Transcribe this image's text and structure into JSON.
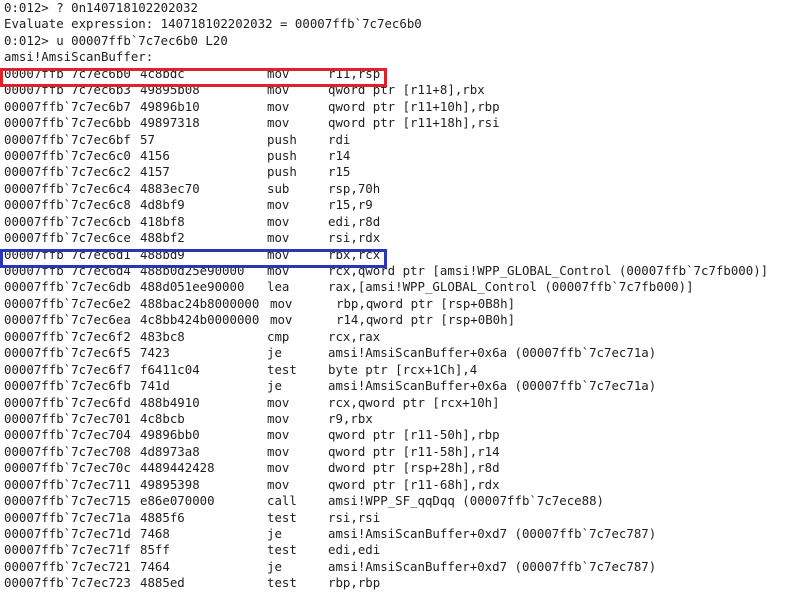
{
  "colors": {
    "red_box": "#e0202a",
    "blue_box": "#2a36b8"
  },
  "header_lines": [
    "0:012> ? 0n140718102202032",
    "Evaluate expression: 140718102202032 = 00007ffb`7c7ec6b0",
    "0:012> u 00007ffb`7c7ec6b0 L20",
    "amsi!AmsiScanBuffer:"
  ],
  "asm_lines": [
    {
      "addr": "00007ffb`7c7ec6b0",
      "bytes": "4c8bdc",
      "mnemonic": "mov",
      "operands": "r11,rsp",
      "highlight": "red"
    },
    {
      "addr": "00007ffb`7c7ec6b3",
      "bytes": "49895b08",
      "mnemonic": "mov",
      "operands": "qword ptr [r11+8],rbx"
    },
    {
      "addr": "00007ffb`7c7ec6b7",
      "bytes": "49896b10",
      "mnemonic": "mov",
      "operands": "qword ptr [r11+10h],rbp"
    },
    {
      "addr": "00007ffb`7c7ec6bb",
      "bytes": "49897318",
      "mnemonic": "mov",
      "operands": "qword ptr [r11+18h],rsi"
    },
    {
      "addr": "00007ffb`7c7ec6bf",
      "bytes": "57",
      "mnemonic": "push",
      "operands": "rdi"
    },
    {
      "addr": "00007ffb`7c7ec6c0",
      "bytes": "4156",
      "mnemonic": "push",
      "operands": "r14"
    },
    {
      "addr": "00007ffb`7c7ec6c2",
      "bytes": "4157",
      "mnemonic": "push",
      "operands": "r15"
    },
    {
      "addr": "00007ffb`7c7ec6c4",
      "bytes": "4883ec70",
      "mnemonic": "sub",
      "operands": "rsp,70h"
    },
    {
      "addr": "00007ffb`7c7ec6c8",
      "bytes": "4d8bf9",
      "mnemonic": "mov",
      "operands": "r15,r9"
    },
    {
      "addr": "00007ffb`7c7ec6cb",
      "bytes": "418bf8",
      "mnemonic": "mov",
      "operands": "edi,r8d"
    },
    {
      "addr": "00007ffb`7c7ec6ce",
      "bytes": "488bf2",
      "mnemonic": "mov",
      "operands": "rsi,rdx"
    },
    {
      "addr": "00007ffb`7c7ec6d1",
      "bytes": "488bd9",
      "mnemonic": "mov",
      "operands": "rbx,rcx",
      "highlight": "blue"
    },
    {
      "addr": "00007ffb`7c7ec6d4",
      "bytes": "488b0d25e90000",
      "mnemonic": "mov",
      "operands": "rcx,qword ptr [amsi!WPP_GLOBAL_Control (00007ffb`7c7fb000)]"
    },
    {
      "addr": "00007ffb`7c7ec6db",
      "bytes": "488d051ee90000",
      "mnemonic": "lea",
      "operands": "rax,[amsi!WPP_GLOBAL_Control (00007ffb`7c7fb000)]"
    },
    {
      "addr": "00007ffb`7c7ec6e2",
      "bytes": "488bac24b8000000",
      "mnemonic": "mov",
      "operands": "rbp,qword ptr [rsp+0B8h]",
      "long": true
    },
    {
      "addr": "00007ffb`7c7ec6ea",
      "bytes": "4c8bb424b0000000",
      "mnemonic": "mov",
      "operands": "r14,qword ptr [rsp+0B0h]",
      "long": true
    },
    {
      "addr": "00007ffb`7c7ec6f2",
      "bytes": "483bc8",
      "mnemonic": "cmp",
      "operands": "rcx,rax"
    },
    {
      "addr": "00007ffb`7c7ec6f5",
      "bytes": "7423",
      "mnemonic": "je",
      "operands": "amsi!AmsiScanBuffer+0x6a (00007ffb`7c7ec71a)"
    },
    {
      "addr": "00007ffb`7c7ec6f7",
      "bytes": "f6411c04",
      "mnemonic": "test",
      "operands": "byte ptr [rcx+1Ch],4"
    },
    {
      "addr": "00007ffb`7c7ec6fb",
      "bytes": "741d",
      "mnemonic": "je",
      "operands": "amsi!AmsiScanBuffer+0x6a (00007ffb`7c7ec71a)"
    },
    {
      "addr": "00007ffb`7c7ec6fd",
      "bytes": "488b4910",
      "mnemonic": "mov",
      "operands": "rcx,qword ptr [rcx+10h]"
    },
    {
      "addr": "00007ffb`7c7ec701",
      "bytes": "4c8bcb",
      "mnemonic": "mov",
      "operands": "r9,rbx"
    },
    {
      "addr": "00007ffb`7c7ec704",
      "bytes": "49896bb0",
      "mnemonic": "mov",
      "operands": "qword ptr [r11-50h],rbp"
    },
    {
      "addr": "00007ffb`7c7ec708",
      "bytes": "4d8973a8",
      "mnemonic": "mov",
      "operands": "qword ptr [r11-58h],r14"
    },
    {
      "addr": "00007ffb`7c7ec70c",
      "bytes": "4489442428",
      "mnemonic": "mov",
      "operands": "dword ptr [rsp+28h],r8d"
    },
    {
      "addr": "00007ffb`7c7ec711",
      "bytes": "49895398",
      "mnemonic": "mov",
      "operands": "qword ptr [r11-68h],rdx"
    },
    {
      "addr": "00007ffb`7c7ec715",
      "bytes": "e86e070000",
      "mnemonic": "call",
      "operands": "amsi!WPP_SF_qqDqq (00007ffb`7c7ece88)"
    },
    {
      "addr": "00007ffb`7c7ec71a",
      "bytes": "4885f6",
      "mnemonic": "test",
      "operands": "rsi,rsi"
    },
    {
      "addr": "00007ffb`7c7ec71d",
      "bytes": "7468",
      "mnemonic": "je",
      "operands": "amsi!AmsiScanBuffer+0xd7 (00007ffb`7c7ec787)"
    },
    {
      "addr": "00007ffb`7c7ec71f",
      "bytes": "85ff",
      "mnemonic": "test",
      "operands": "edi,edi"
    },
    {
      "addr": "00007ffb`7c7ec721",
      "bytes": "7464",
      "mnemonic": "je",
      "operands": "amsi!AmsiScanBuffer+0xd7 (00007ffb`7c7ec787)"
    },
    {
      "addr": "00007ffb`7c7ec723",
      "bytes": "4885ed",
      "mnemonic": "test",
      "operands": "rbp,rbp"
    }
  ]
}
